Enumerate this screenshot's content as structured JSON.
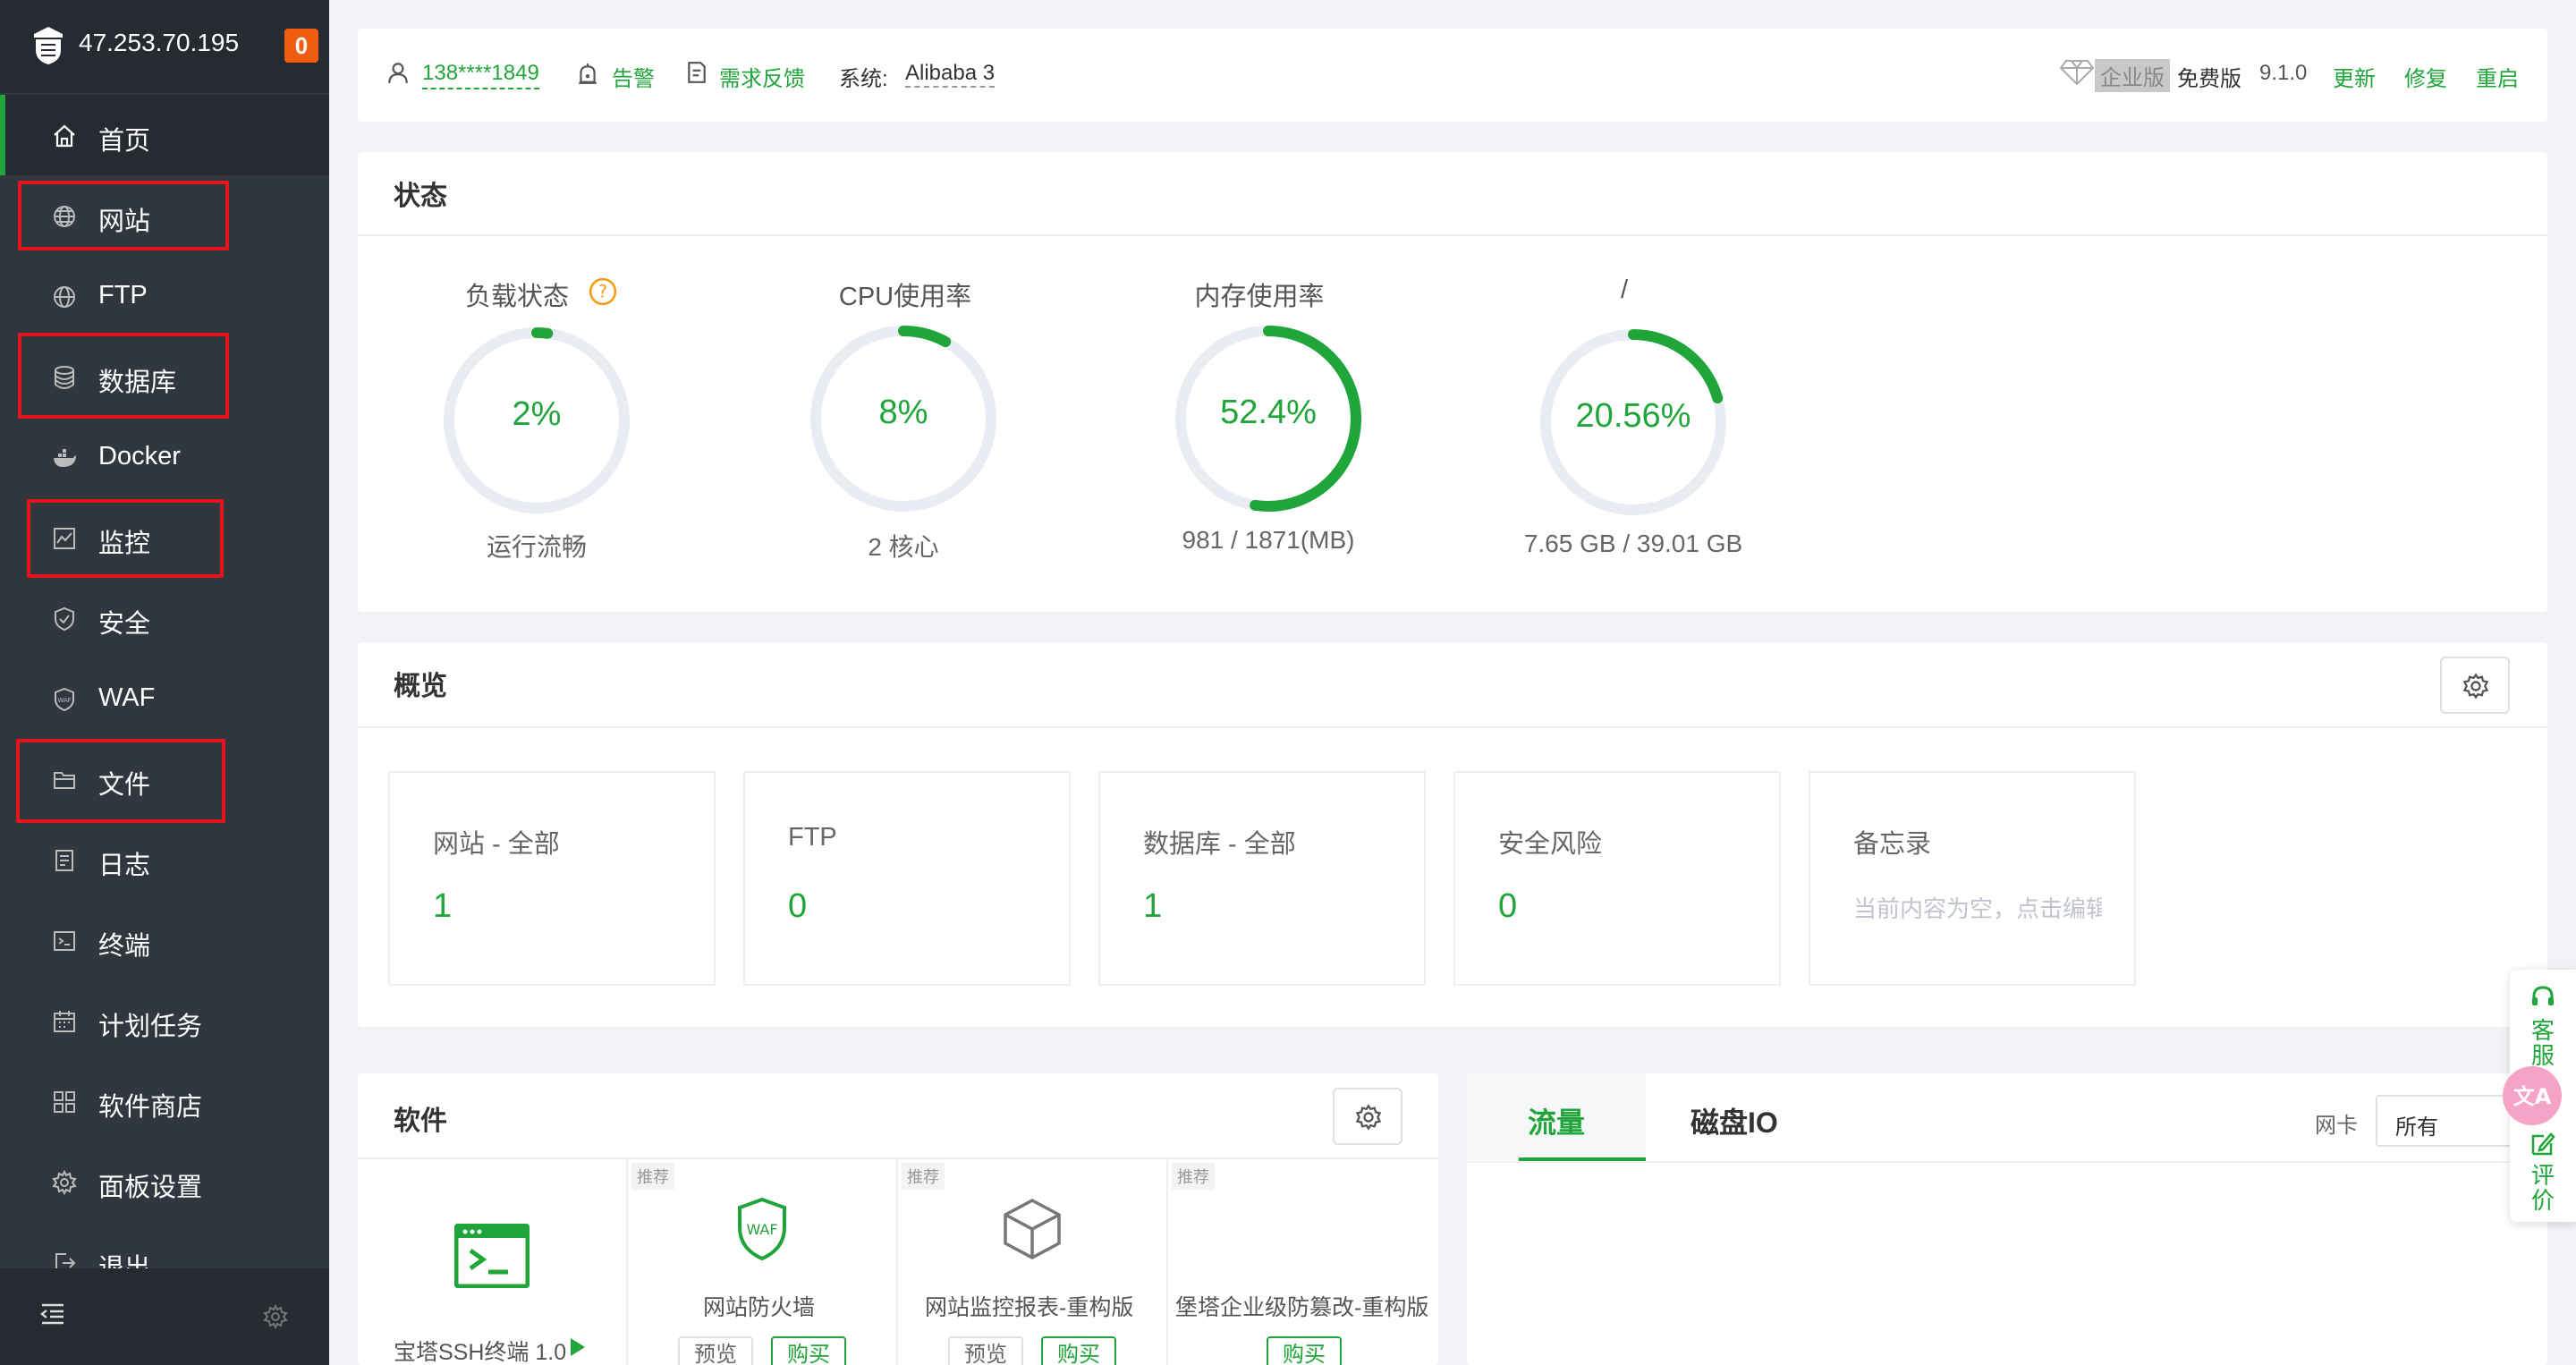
{
  "sidebar": {
    "ip": "47.253.70.195",
    "badge": "0",
    "items": [
      {
        "label": "首页",
        "icon": "home-icon"
      },
      {
        "label": "网站",
        "icon": "globe-icon"
      },
      {
        "label": "FTP",
        "icon": "ftp-icon"
      },
      {
        "label": "数据库",
        "icon": "database-icon"
      },
      {
        "label": "Docker",
        "icon": "docker-icon"
      },
      {
        "label": "监控",
        "icon": "monitor-icon"
      },
      {
        "label": "安全",
        "icon": "shield-icon"
      },
      {
        "label": "WAF",
        "icon": "waf-icon"
      },
      {
        "label": "文件",
        "icon": "folder-icon"
      },
      {
        "label": "日志",
        "icon": "log-icon"
      },
      {
        "label": "终端",
        "icon": "terminal-icon"
      },
      {
        "label": "计划任务",
        "icon": "calendar-icon"
      },
      {
        "label": "软件商店",
        "icon": "apps-icon"
      },
      {
        "label": "面板设置",
        "icon": "gear-icon"
      },
      {
        "label": "退出",
        "icon": "logout-icon"
      }
    ]
  },
  "header": {
    "user": "138****1849",
    "alert": "告警",
    "feedback": "需求反馈",
    "system_label": "系统:",
    "system_value": "Alibaba 3",
    "enterprise": "企业版",
    "edition": "免费版",
    "version": "9.1.0",
    "update": "更新",
    "repair": "修复",
    "restart": "重启"
  },
  "status": {
    "title": "状态",
    "gauges": [
      {
        "title": "负载状态",
        "value": "2%",
        "percent": 2,
        "sub": "运行流畅"
      },
      {
        "title": "CPU使用率",
        "value": "8%",
        "percent": 8,
        "sub": "2 核心"
      },
      {
        "title": "内存使用率",
        "value": "52.4%",
        "percent": 52.4,
        "sub": "981 / 1871(MB)"
      },
      {
        "title": "/",
        "value": "20.56%",
        "percent": 20.56,
        "sub": "7.65 GB / 39.01 GB"
      }
    ]
  },
  "overview": {
    "title": "概览",
    "cards": [
      {
        "title": "网站 - 全部",
        "value": "1"
      },
      {
        "title": "FTP",
        "value": "0"
      },
      {
        "title": "数据库 - 全部",
        "value": "1"
      },
      {
        "title": "安全风险",
        "value": "0"
      },
      {
        "title": "备忘录",
        "memo": "当前内容为空，点击编辑"
      }
    ]
  },
  "software": {
    "title": "软件",
    "tag": "推荐",
    "items": [
      {
        "name": "宝塔SSH终端 1.0"
      },
      {
        "name": "网站防火墙",
        "preview": "预览",
        "buy": "购买"
      },
      {
        "name": "网站监控报表-重构版",
        "preview": "预览",
        "buy": "购买"
      },
      {
        "name": "堡塔企业级防篡改-重构版",
        "buy": "购买"
      }
    ]
  },
  "traffic": {
    "tab_flow": "流量",
    "tab_disk": "磁盘IO",
    "nic_label": "网卡",
    "nic_value": "所有"
  },
  "float_widget": {
    "service": "客服",
    "review": "评价"
  },
  "colors": {
    "accent": "#20a53a",
    "sidebar": "#30373e",
    "badge": "#f05d10",
    "highlight": "#e8141c"
  }
}
